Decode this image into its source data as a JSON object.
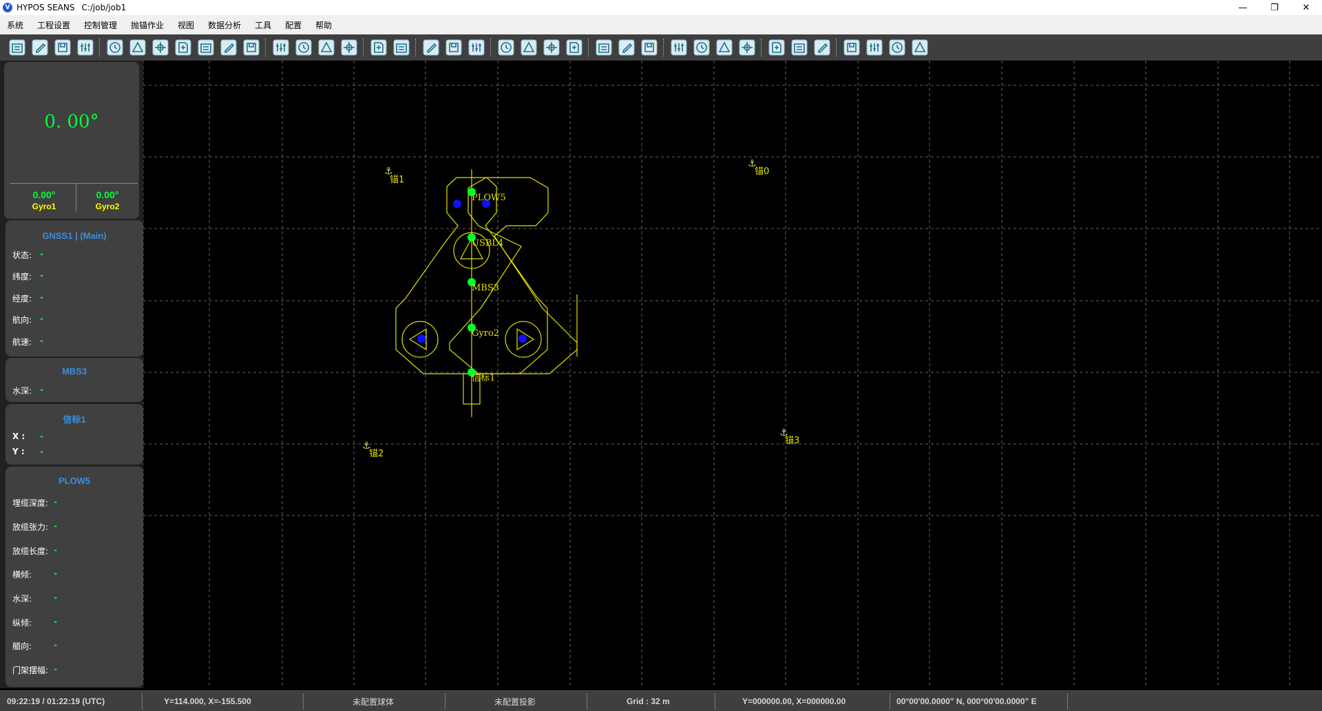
{
  "window": {
    "app_name": "HYPOS SEANS",
    "logo_letter": "V",
    "job_path": "C:/job/job1",
    "minimize": "—",
    "maximize": "❐",
    "close": "✕"
  },
  "menu": [
    "系统",
    "工程设置",
    "控制管理",
    "抛锚作业",
    "视图",
    "数据分析",
    "工具",
    "配置",
    "帮助"
  ],
  "toolbar_icons": [
    "new-project-icon",
    "open-file-icon",
    "edit-file-icon",
    "save-file-icon",
    "sep",
    "settings-sliders-icon",
    "user-settings-icon",
    "compass-icon",
    "target-icon",
    "vessel-icon",
    "chart-icon",
    "report-icon",
    "sep",
    "play-icon",
    "history-icon",
    "person-icon",
    "stop-icon",
    "sep",
    "route-icon",
    "lighthouse-icon",
    "sep",
    "arc-icon",
    "location-pin-icon",
    "anchor-icon",
    "sep",
    "zoom-extend-icon",
    "zoom-shrink-icon",
    "zoom-fit-icon",
    "map-pin-icon",
    "sep",
    "map-icon",
    "record-icon",
    "flag-icon",
    "sep",
    "diver-icon",
    "map-edit-icon",
    "satellite-icon",
    "signal-icon",
    "sep",
    "equalizer-icon",
    "layers-icon",
    "link-icon",
    "sep",
    "ruler-icon",
    "measure-icon",
    "pen-icon",
    "erase-icon"
  ],
  "heading_panel": {
    "heading": "0. 00°",
    "gyro1_value": "0.00°",
    "gyro1_label": "Gyro1",
    "gyro2_value": "0.00°",
    "gyro2_label": "Gyro2"
  },
  "gnss_panel": {
    "title": "GNSS1 | (Main)",
    "rows": [
      {
        "label": "状态:",
        "value": "-"
      },
      {
        "label": "纬度:",
        "value": "-"
      },
      {
        "label": "经度:",
        "value": "-"
      },
      {
        "label": "航向:",
        "value": "-"
      },
      {
        "label": "航速:",
        "value": "-"
      }
    ]
  },
  "mbs_panel": {
    "title": "MBS3",
    "rows": [
      {
        "label": "水深:",
        "value": "-"
      }
    ]
  },
  "beacon_panel": {
    "title": "信标1",
    "rows": [
      {
        "label": "X :",
        "value": "-"
      },
      {
        "label": "Y :",
        "value": "-"
      }
    ]
  },
  "plow_panel": {
    "title": "PLOW5",
    "rows": [
      {
        "label": "埋缆深度:",
        "value": "-"
      },
      {
        "label": "放缆张力:",
        "value": "-"
      },
      {
        "label": "放缆长度:",
        "value": "-"
      },
      {
        "label": "横倾:",
        "value": "-"
      },
      {
        "label": "水深:",
        "value": "-"
      },
      {
        "label": "纵倾:",
        "value": "-"
      },
      {
        "label": "艏向:",
        "value": "-"
      },
      {
        "label": "门架摆幅:",
        "value": "-"
      }
    ]
  },
  "map": {
    "anchors": [
      "锚0",
      "锚1",
      "锚2",
      "锚3"
    ],
    "vessel_labels": [
      "PLOW5",
      "USBL4",
      "MBS3",
      "Gyro2",
      "信标1"
    ],
    "colors": {
      "vessel": "#e3e000",
      "sensor": "#00ff2a",
      "thruster": "#1010ff",
      "grid": "#666666",
      "anchor": "#c8e06a"
    }
  },
  "status": {
    "time": "09:22:19 / 01:22:19 (UTC)",
    "cursor": "Y=114.000, X=-155.500",
    "ellipsoid": "未配置球体",
    "projection": "未配置投影",
    "grid": "Grid : 32 m",
    "center": "Y=000000.00, X=000000.00",
    "latlon": "00°00'00.0000\" N, 000°00'00.0000\" E"
  }
}
